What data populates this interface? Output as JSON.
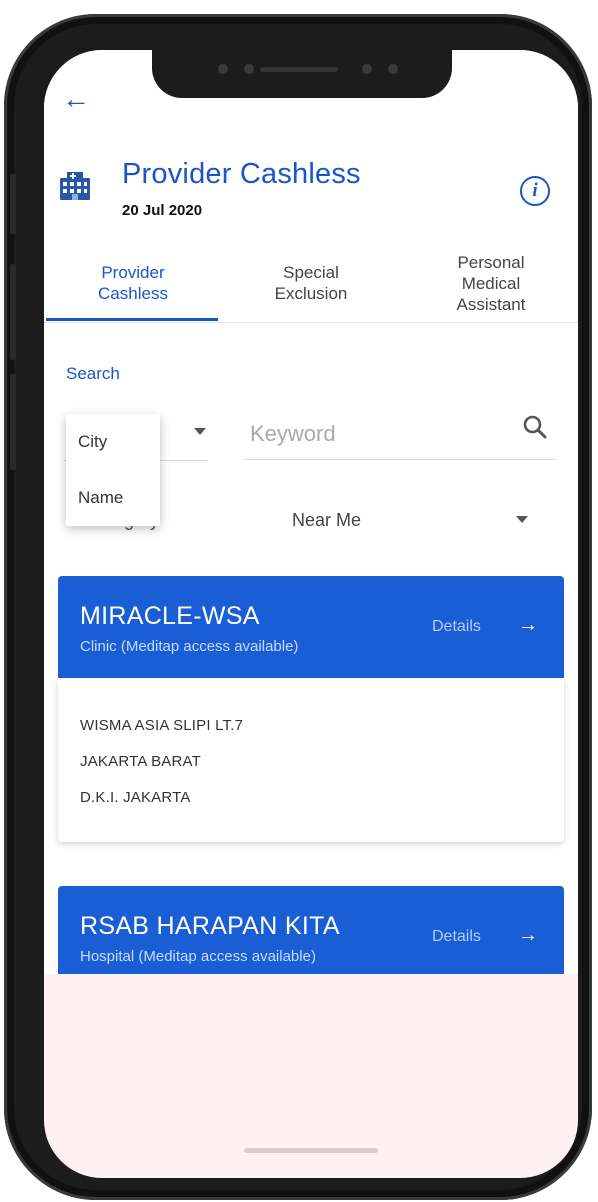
{
  "header": {
    "title": "Provider Cashless",
    "date": "20 Jul 2020"
  },
  "tabs": [
    {
      "label": "Provider\nCashless",
      "active": true
    },
    {
      "label": "Special\nExclusion",
      "active": false
    },
    {
      "label": "Personal\nMedical\nAssistant",
      "active": false
    }
  ],
  "search": {
    "label": "Search",
    "keyword_placeholder": "Keyword",
    "filter_options": [
      "City",
      "Name"
    ]
  },
  "category": {
    "label": "Category",
    "value": "Near Me"
  },
  "providers": [
    {
      "name": "MIRACLE-WSA",
      "type": "Clinic (Meditap access available)",
      "details_label": "Details",
      "address": [
        "WISMA ASIA SLIPI LT.7",
        "JAKARTA BARAT",
        "D.K.I. JAKARTA"
      ]
    },
    {
      "name": "RSAB HARAPAN KITA",
      "type": "Hospital (Meditap access available)",
      "details_label": "Details"
    }
  ],
  "colors": {
    "accent": "#1a55c8",
    "card_header": "#1a5ed6",
    "phone_frame": "#1c1c1c",
    "screen_bg": "#fdf1f4"
  },
  "icons": {
    "back": "arrow-left",
    "header": "hospital-building",
    "info": "info-circle",
    "search": "magnifier",
    "details": "arrow-right"
  }
}
